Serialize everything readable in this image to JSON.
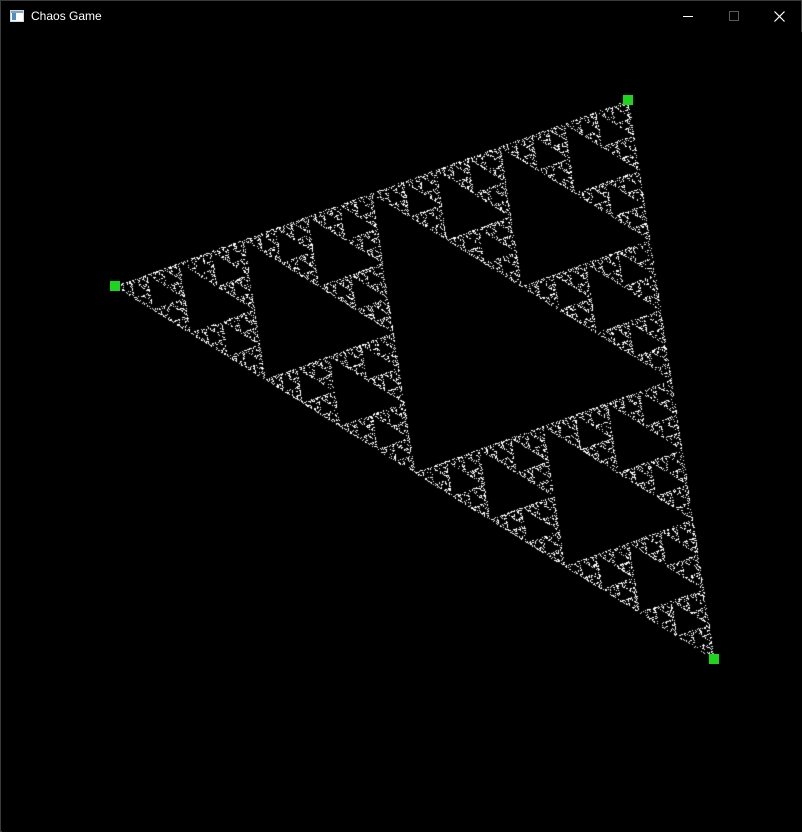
{
  "window": {
    "title": "Chaos Game",
    "icon": "app-window-icon",
    "controls": {
      "minimize_icon": "minimize-icon",
      "maximize_icon": "maximize-icon",
      "close_icon": "close-icon"
    }
  },
  "canvas": {
    "background_color": "#000000",
    "point_color": "#ffffff",
    "vertex_color": "#1cd61c",
    "vertices": [
      {
        "name": "left-vertex"
      },
      {
        "name": "top-vertex"
      },
      {
        "name": "bottom-vertex"
      }
    ]
  }
}
